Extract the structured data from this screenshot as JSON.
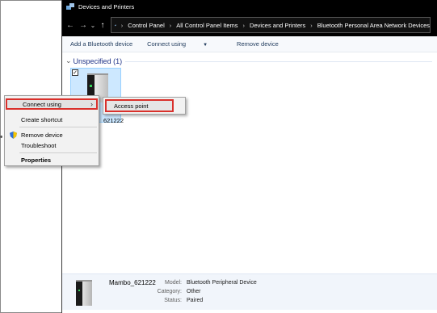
{
  "window": {
    "title": "Devices and Printers"
  },
  "nav": {
    "back": "←",
    "forward": "→",
    "dropdown": "⌄",
    "up": "↑",
    "crumbs": [
      "Control Panel",
      "All Control Panel Items",
      "Devices and Printers",
      "Bluetooth Personal Area Network Devices"
    ],
    "separator": "›"
  },
  "toolbar": {
    "add_bluetooth_device": "Add a Bluetooth device",
    "connect_using": "Connect using",
    "remove_device": "Remove device"
  },
  "section": {
    "title": "Unspecified (1)",
    "chevron": "⌄"
  },
  "device_tile": {
    "label_visible": "621222",
    "checked": "✓"
  },
  "context_menu": {
    "connect_using": "Connect using",
    "create_shortcut": "Create shortcut",
    "remove_device": "Remove device",
    "troubleshoot": "Troubleshoot",
    "properties": "Properties",
    "arrow": "›"
  },
  "submenu": {
    "access_point": "Access point"
  },
  "details": {
    "name": "Mambo_621222",
    "model_label": "Model:",
    "model_value": "Bluetooth Peripheral Device",
    "category_label": "Category:",
    "category_value": "Other",
    "status_label": "Status:",
    "status_value": "Paired"
  },
  "colors": {
    "highlight_border": "#d9302b",
    "selection": "#cde8ff",
    "titlebar": "#000000",
    "link": "#1e395b"
  }
}
